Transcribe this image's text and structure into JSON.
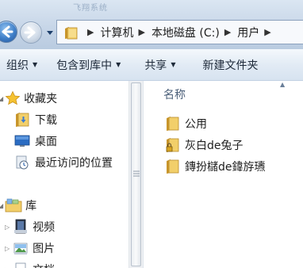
{
  "window": {
    "ghost_title": "飞翔系统"
  },
  "addressbar": {
    "crumbs": [
      "计算机",
      "本地磁盘 (C:)",
      "用户"
    ],
    "separator": "▶"
  },
  "toolbar": {
    "organize": "组织",
    "include_in_library": "包含到库中",
    "share": "共享",
    "new_folder": "新建文件夹",
    "dropdown_glyph": "▼"
  },
  "navpane": {
    "favorites": {
      "label": "收藏夹",
      "items": [
        {
          "label": "下载",
          "icon": "downloads-folder-icon"
        },
        {
          "label": "桌面",
          "icon": "desktop-icon"
        },
        {
          "label": "最近访问的位置",
          "icon": "recent-places-icon"
        }
      ]
    },
    "libraries": {
      "label": "库",
      "items": [
        {
          "label": "视频",
          "icon": "videos-library-icon"
        },
        {
          "label": "图片",
          "icon": "pictures-library-icon"
        },
        {
          "label": "文档",
          "icon": "documents-library-icon"
        }
      ]
    }
  },
  "content": {
    "column_name": "名称",
    "sort_glyph": "▲",
    "items": [
      {
        "label": "公用",
        "icon": "folder-icon"
      },
      {
        "label": "灰白de兔子",
        "icon": "locked-folder-icon"
      },
      {
        "label": "鏄扮櫧de鍏斿瓙",
        "icon": "folder-icon"
      }
    ]
  },
  "colors": {
    "toolbar_text": "#1e2a3a",
    "header_text": "#4c607a",
    "folder": "#e8c15a"
  }
}
